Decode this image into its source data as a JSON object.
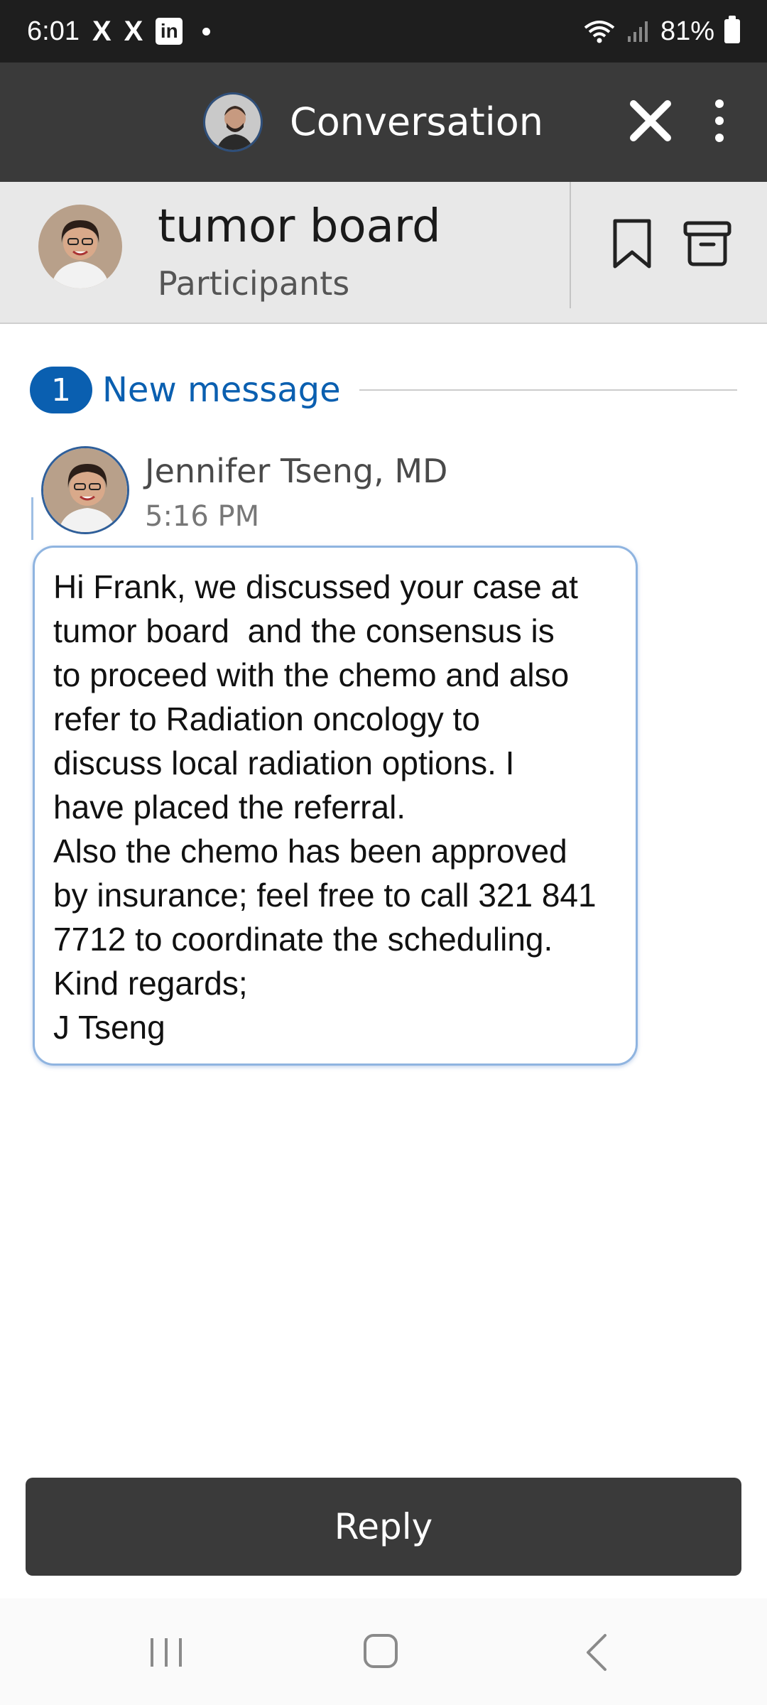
{
  "status_bar": {
    "time": "6:01",
    "notif_icons": [
      "X",
      "X",
      "in"
    ],
    "battery": "81%"
  },
  "app_bar": {
    "title": "Conversation"
  },
  "conversation": {
    "title": "tumor board",
    "participants_label": "Participants"
  },
  "new_messages": {
    "count": "1",
    "label": "New message"
  },
  "message": {
    "sender": "Jennifer Tseng, MD",
    "time": "5:16 PM",
    "lines": [
      "Hi Frank, we discussed your case at",
      "tumor board  and the consensus is",
      "to proceed with the chemo and also",
      "refer to Radiation oncology to",
      "discuss local radiation options. I",
      "have placed the referral.",
      "Also the chemo has been approved",
      "by insurance; feel free to call 321 841",
      "7712 to coordinate the scheduling.",
      "Kind regards;",
      "J Tseng"
    ]
  },
  "reply_label": "Reply",
  "colors": {
    "accent": "#0a5fb0",
    "app_bar": "#3a3a3a",
    "header_bg": "#e8e8e8",
    "bubble_border": "#8fb4e0"
  }
}
